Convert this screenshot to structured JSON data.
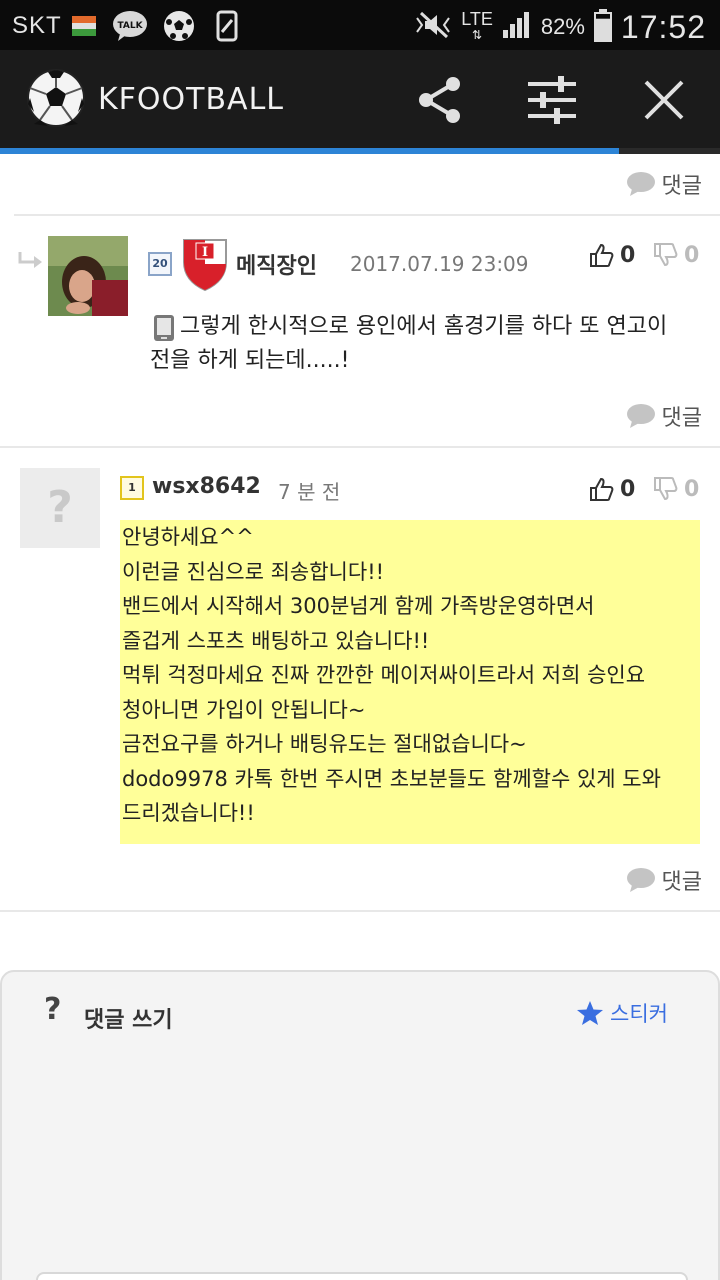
{
  "status_bar": {
    "carrier": "SKT",
    "network": "LTE",
    "battery": "82%",
    "battery_level": 0.82,
    "time": "17:52",
    "icons": [
      "flag-icon",
      "kakaotalk-icon",
      "soccer-ball-icon",
      "screenshot-icon",
      "mute-vibrate-icon",
      "signal-icon",
      "battery-icon"
    ]
  },
  "app_bar": {
    "title": "KFOOTBALL",
    "icons": [
      "soccer-ball-logo-icon",
      "share-icon",
      "settings-sliders-icon",
      "close-icon"
    ],
    "progress": 0.86,
    "accent": "#2d84d6"
  },
  "reply_label": "댓글",
  "comments": [
    {
      "author": "메직장인",
      "level": "20",
      "date": "2017.07.19 23:09",
      "likes": "0",
      "dislikes": "0",
      "is_reply": true,
      "device_icon": "mobile-device-icon",
      "text_lines": [
        "그렇게 한시적으로 용인에서 홈경기를 하다 또 연고이",
        "전을 하게 되는데.....!"
      ]
    },
    {
      "author": "wsx8642",
      "level": "1",
      "date": "7 분 전",
      "likes": "0",
      "dislikes": "0",
      "highlight_color": "#ffff99",
      "text_lines": [
        "안녕하세요^^",
        "이런글 진심으로 죄송합니다!!",
        "밴드에서 시작해서 300분넘게 함께 가족방운영하면서",
        "즐겁게 스포츠 배팅하고 있습니다!!",
        "먹튀 걱정마세요 진짜 깐깐한 메이저싸이트라서 저희 승인요",
        "청아니면 가입이 안됩니다~",
        "금전요구를 하거나 배팅유도는 절대없습니다~",
        "dodo9978 카톡 한번 주시면 초보분들도 함께할수 있게 도와",
        "드리겠습니다!!"
      ]
    }
  ],
  "write_box": {
    "help_mark": "?",
    "label": "댓글 쓰기",
    "sticker_label": "스티커",
    "sticker_color": "#3a6ee0"
  }
}
